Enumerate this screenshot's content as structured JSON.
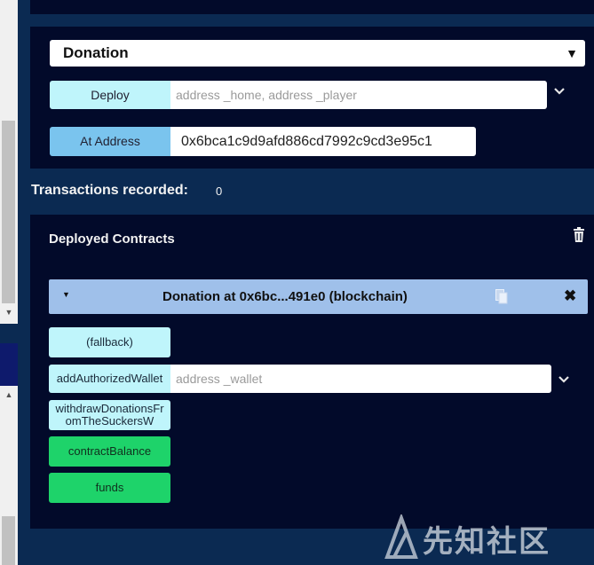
{
  "deploy_panel": {
    "contract_select": "Donation",
    "deploy_label": "Deploy",
    "deploy_placeholder": "address _home, address _player",
    "at_address_label": "At Address",
    "at_address_value": "0x6bca1c9d9afd886cd7992c9cd3e95c1"
  },
  "transactions": {
    "label": "Transactions recorded:",
    "count": "0"
  },
  "deployed": {
    "title": "Deployed Contracts",
    "instance_title": "Donation at 0x6bc...491e0 (blockchain)",
    "functions": [
      {
        "label": "(fallback)",
        "kind": "payable"
      },
      {
        "label": "addAuthorizedWallet",
        "kind": "transact",
        "placeholder": "address _wallet"
      },
      {
        "label": "withdrawDonationsFromTheSuckersW",
        "kind": "transact"
      },
      {
        "label": "contractBalance",
        "kind": "call"
      },
      {
        "label": "funds",
        "kind": "call"
      }
    ]
  },
  "watermark": {
    "text": "先知社区"
  },
  "icons": {
    "select_caret": "dropdown-caret-icon",
    "chevron": "chevron-down-icon",
    "trash": "trash-icon",
    "copy": "copy-icon",
    "close": "close-icon"
  },
  "colors": {
    "panel_bg": "#020a2a",
    "page_bg": "#0b2a52",
    "transact_button": "#bff5fb",
    "at_address_button": "#7ac4ee",
    "call_button": "#1ed36a",
    "instance_bar": "#9fc0ea"
  }
}
